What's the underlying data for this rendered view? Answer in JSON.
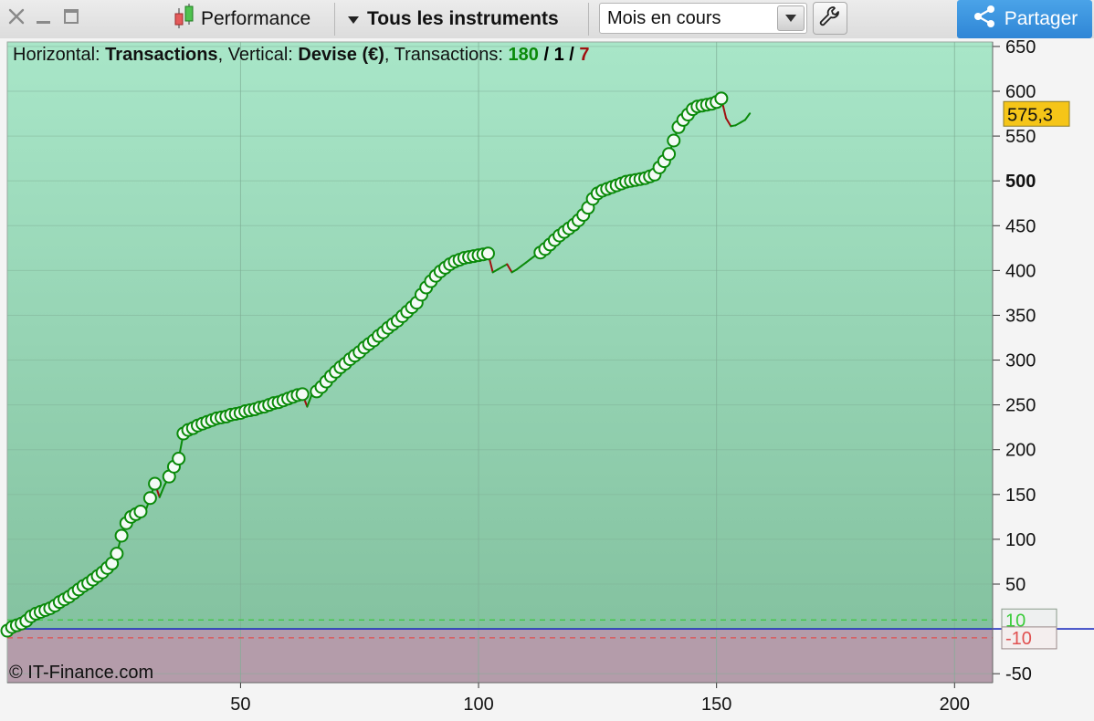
{
  "toolbar": {
    "performance_label": "Performance",
    "instruments_label": "Tous les instruments",
    "period_value": "Mois en cours",
    "share_label": "Partager"
  },
  "header": {
    "horizontal_label": "Horizontal:",
    "horizontal_value": "Transactions",
    "vertical_label": "Vertical:",
    "vertical_value": "Devise (€)",
    "transactions_label": "Transactions:",
    "count_green": "180",
    "count_black": "1",
    "count_red": "7",
    "slash": "/"
  },
  "copyright": "© IT-Finance.com",
  "colors": {
    "accent_blue": "#2f86d6",
    "win_green": "#0a8a0a",
    "loss_red": "#a01010",
    "last_value_badge": "#f5c518",
    "zero_line": "#1f2fbf"
  },
  "chart_data": {
    "type": "line",
    "title": "",
    "xlabel": "",
    "ylabel": "",
    "xlim": [
      1,
      208
    ],
    "ylim": [
      -60,
      655
    ],
    "x_ticks": [
      50,
      100,
      150,
      200
    ],
    "y_ticks": [
      650,
      600,
      550,
      500,
      450,
      400,
      350,
      300,
      250,
      200,
      150,
      100,
      50,
      -50
    ],
    "y_tick_bold": 500,
    "last_value": 575.3,
    "last_value_label": "575,3",
    "threshold_upper": 10,
    "threshold_upper_label": "10",
    "threshold_lower": -10,
    "threshold_lower_label": "-10",
    "grid": true,
    "series": [
      {
        "points": [
          [
            1,
            -2
          ],
          [
            2,
            2
          ],
          [
            3,
            4
          ],
          [
            4,
            6
          ],
          [
            5,
            9
          ],
          [
            6,
            14
          ],
          [
            7,
            17
          ],
          [
            8,
            19
          ],
          [
            9,
            21
          ],
          [
            10,
            23
          ],
          [
            11,
            26
          ],
          [
            12,
            30
          ],
          [
            13,
            33
          ],
          [
            14,
            36
          ],
          [
            15,
            40
          ],
          [
            16,
            44
          ],
          [
            17,
            48
          ],
          [
            18,
            51
          ],
          [
            19,
            55
          ],
          [
            20,
            59
          ],
          [
            21,
            63
          ],
          [
            22,
            68
          ],
          [
            23,
            73
          ],
          [
            24,
            84
          ],
          [
            25,
            104
          ],
          [
            26,
            118
          ],
          [
            27,
            125
          ],
          [
            28,
            128
          ],
          [
            29,
            131
          ],
          [
            30,
            131
          ],
          [
            31,
            146
          ],
          [
            32,
            162
          ],
          [
            33,
            147
          ],
          [
            34,
            160
          ],
          [
            35,
            170
          ],
          [
            36,
            181
          ],
          [
            37,
            190
          ],
          [
            38,
            218
          ],
          [
            39,
            222
          ],
          [
            40,
            224
          ],
          [
            41,
            227
          ],
          [
            42,
            229
          ],
          [
            43,
            231
          ],
          [
            44,
            233
          ],
          [
            45,
            235
          ],
          [
            46,
            236
          ],
          [
            47,
            237
          ],
          [
            48,
            239
          ],
          [
            49,
            240
          ],
          [
            50,
            241
          ],
          [
            51,
            243
          ],
          [
            52,
            244
          ],
          [
            53,
            245
          ],
          [
            54,
            247
          ],
          [
            55,
            248
          ],
          [
            56,
            250
          ],
          [
            57,
            252
          ],
          [
            58,
            253
          ],
          [
            59,
            255
          ],
          [
            60,
            257
          ],
          [
            61,
            259
          ],
          [
            62,
            261
          ],
          [
            63,
            262
          ],
          [
            64,
            248
          ],
          [
            65,
            262
          ],
          [
            66,
            265
          ],
          [
            67,
            270
          ],
          [
            68,
            276
          ],
          [
            69,
            282
          ],
          [
            70,
            287
          ],
          [
            71,
            292
          ],
          [
            72,
            296
          ],
          [
            73,
            301
          ],
          [
            74,
            305
          ],
          [
            75,
            309
          ],
          [
            76,
            314
          ],
          [
            77,
            318
          ],
          [
            78,
            322
          ],
          [
            79,
            327
          ],
          [
            80,
            331
          ],
          [
            81,
            336
          ],
          [
            82,
            340
          ],
          [
            83,
            344
          ],
          [
            84,
            349
          ],
          [
            85,
            354
          ],
          [
            86,
            359
          ],
          [
            87,
            364
          ],
          [
            88,
            373
          ],
          [
            89,
            381
          ],
          [
            90,
            388
          ],
          [
            91,
            394
          ],
          [
            92,
            399
          ],
          [
            93,
            403
          ],
          [
            94,
            407
          ],
          [
            95,
            410
          ],
          [
            96,
            412
          ],
          [
            97,
            414
          ],
          [
            98,
            415
          ],
          [
            99,
            416
          ],
          [
            100,
            417
          ],
          [
            101,
            418
          ],
          [
            102,
            419
          ],
          [
            103,
            398
          ],
          [
            104,
            401
          ],
          [
            105,
            404
          ],
          [
            106,
            407
          ],
          [
            107,
            398
          ],
          [
            108,
            401
          ],
          [
            109,
            405
          ],
          [
            110,
            409
          ],
          [
            111,
            413
          ],
          [
            112,
            417
          ],
          [
            113,
            420
          ],
          [
            114,
            424
          ],
          [
            115,
            429
          ],
          [
            116,
            434
          ],
          [
            117,
            439
          ],
          [
            118,
            443
          ],
          [
            119,
            447
          ],
          [
            120,
            451
          ],
          [
            121,
            456
          ],
          [
            122,
            462
          ],
          [
            123,
            470
          ],
          [
            124,
            480
          ],
          [
            125,
            486
          ],
          [
            126,
            489
          ],
          [
            127,
            491
          ],
          [
            128,
            493
          ],
          [
            129,
            495
          ],
          [
            130,
            497
          ],
          [
            131,
            499
          ],
          [
            132,
            500
          ],
          [
            133,
            501
          ],
          [
            134,
            502
          ],
          [
            135,
            503
          ],
          [
            136,
            505
          ],
          [
            137,
            507
          ],
          [
            138,
            515
          ],
          [
            139,
            522
          ],
          [
            140,
            530
          ],
          [
            141,
            545
          ],
          [
            142,
            560
          ],
          [
            143,
            568
          ],
          [
            144,
            574
          ],
          [
            145,
            580
          ],
          [
            146,
            583
          ],
          [
            147,
            584
          ],
          [
            148,
            585
          ],
          [
            149,
            586
          ],
          [
            150,
            588
          ],
          [
            151,
            592
          ],
          [
            152,
            570
          ],
          [
            153,
            561
          ],
          [
            154,
            562
          ],
          [
            155,
            565
          ],
          [
            156,
            568
          ],
          [
            157,
            575.3
          ]
        ]
      }
    ]
  }
}
